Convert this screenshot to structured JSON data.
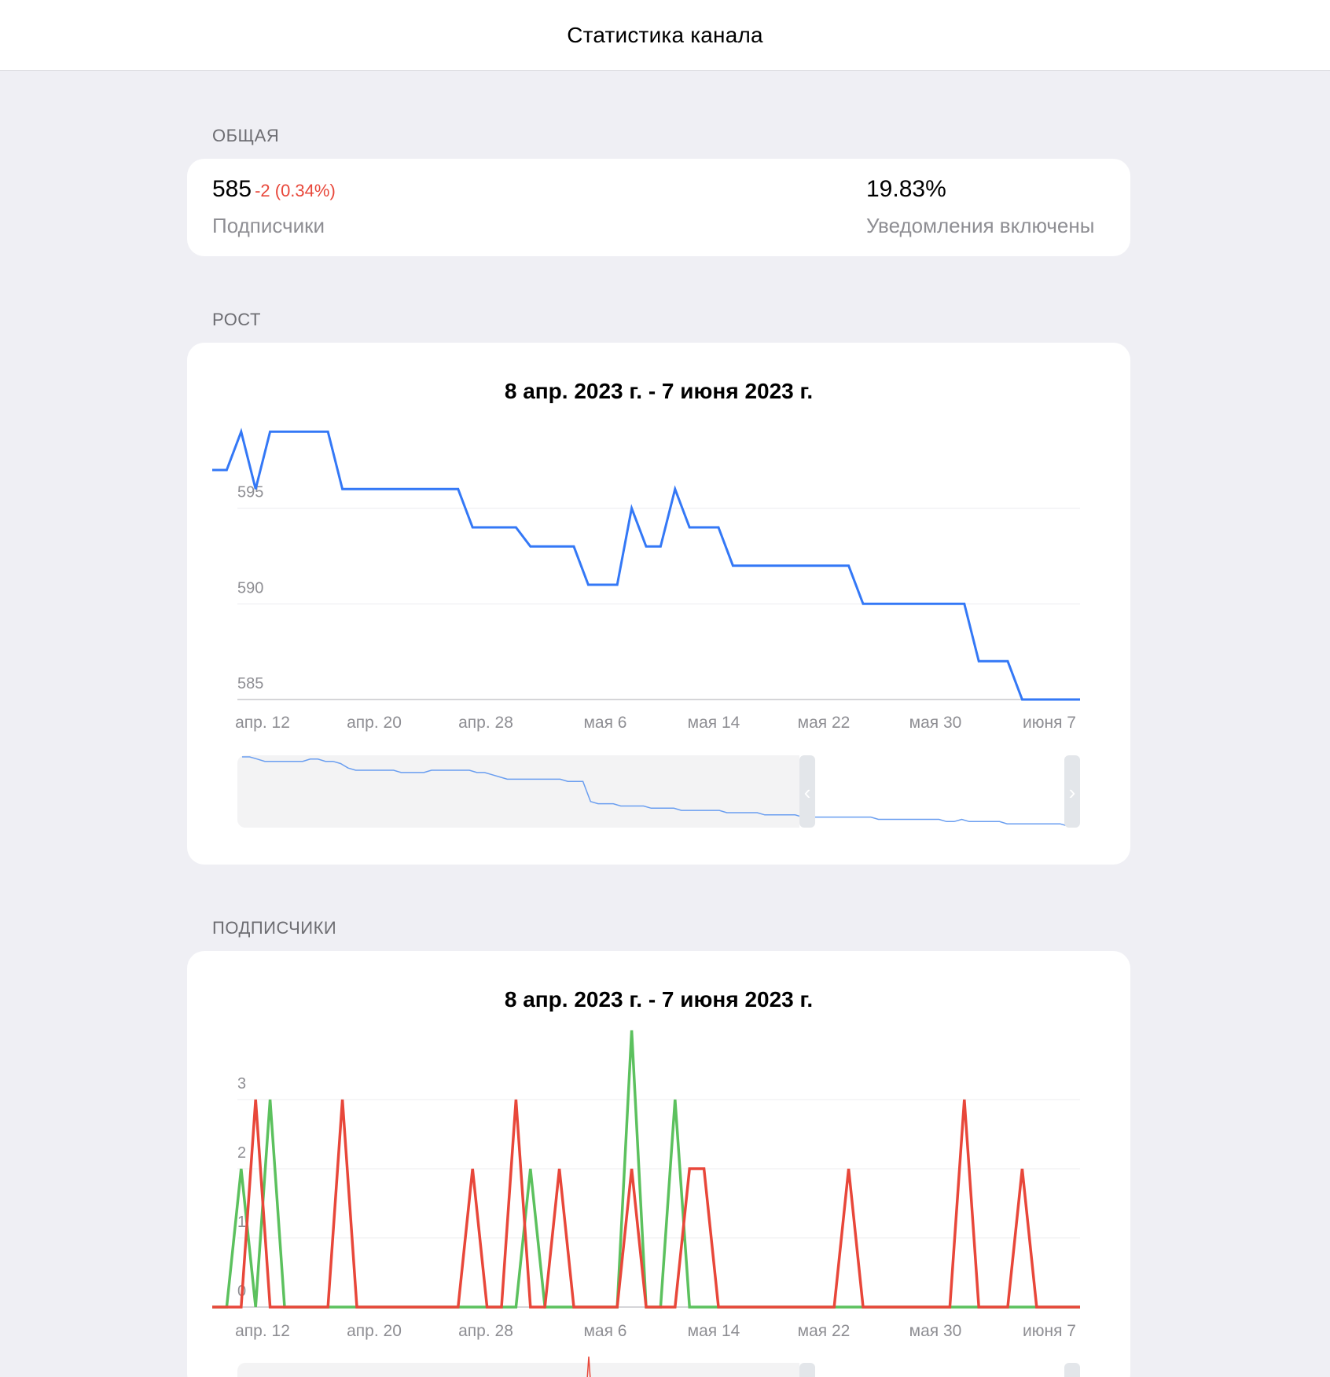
{
  "header": {
    "title": "Статистика канала"
  },
  "overview": {
    "section_label": "ОБЩАЯ",
    "subscribers": {
      "value": "585",
      "delta": "-2 (0.34%)",
      "caption": "Подписчики"
    },
    "notifications": {
      "value": "19.83%",
      "caption": "Уведомления включены"
    }
  },
  "growth": {
    "section_label": "РОСТ",
    "range_title": "8 апр. 2023 г. - 7 июня 2023 г.",
    "line_color": "#3478f6"
  },
  "followers": {
    "section_label": "ПОДПИСЧИКИ",
    "range_title": "8 апр. 2023 г. - 7 июня 2023 г.",
    "joined_color": "#5cc15e",
    "left_color": "#e8473a"
  },
  "chart_data": [
    {
      "type": "line",
      "x_ticks": [
        "апр. 12",
        "апр. 20",
        "апр. 28",
        "мая 6",
        "мая 14",
        "мая 22",
        "мая 30",
        "июня 7"
      ],
      "y_ticks": [
        "585",
        "590",
        "595"
      ],
      "ylim": [
        585,
        600
      ],
      "grid": true,
      "series": [
        {
          "values": [
            597,
            597,
            599,
            596,
            599,
            599,
            599,
            599,
            599,
            596,
            596,
            596,
            596,
            596,
            596,
            596,
            596,
            596,
            594,
            594,
            594,
            594,
            593,
            593,
            593,
            593,
            591,
            591,
            591,
            595,
            593,
            593,
            596,
            594,
            594,
            594,
            592,
            592,
            592,
            592,
            592,
            592,
            592,
            592,
            592,
            590,
            590,
            590,
            590,
            590,
            590,
            590,
            590,
            587,
            587,
            587,
            585,
            585,
            585,
            585,
            585
          ]
        }
      ],
      "navigator": {
        "values": [
          616,
          616,
          615,
          614,
          614,
          614,
          614,
          614,
          614,
          615,
          615,
          614,
          614,
          613,
          611,
          610,
          610,
          610,
          610,
          610,
          610,
          609,
          609,
          609,
          609,
          610,
          610,
          610,
          610,
          610,
          610,
          609,
          609,
          608,
          607,
          606,
          606,
          606,
          606,
          606,
          606,
          606,
          606,
          605,
          605,
          605,
          596,
          595,
          595,
          595,
          594,
          594,
          594,
          594,
          593,
          593,
          593,
          593,
          592,
          592,
          592,
          592,
          592,
          592,
          591,
          591,
          591,
          591,
          591,
          590,
          590,
          590,
          590,
          590,
          589,
          589,
          589,
          589,
          589,
          589,
          589,
          589,
          589,
          589,
          588,
          588,
          588,
          588,
          588,
          588,
          588,
          588,
          588,
          587,
          587,
          588,
          587,
          587,
          587,
          587,
          587,
          586,
          586,
          586,
          586,
          586,
          586,
          586,
          586,
          585,
          585
        ],
        "selected_range": [
          0.667,
          1.0
        ]
      }
    },
    {
      "type": "line",
      "x_ticks": [
        "апр. 12",
        "апр. 20",
        "апр. 28",
        "мая 6",
        "мая 14",
        "мая 22",
        "мая 30",
        "июня 7"
      ],
      "y_ticks": [
        "0",
        "1",
        "2",
        "3"
      ],
      "ylim": [
        0,
        4
      ],
      "grid": true,
      "series": [
        {
          "color": "#5cc15e",
          "values": [
            0,
            0,
            2,
            0,
            3,
            0,
            0,
            0,
            0,
            0,
            0,
            0,
            0,
            0,
            0,
            0,
            0,
            0,
            0,
            0,
            0,
            0,
            2,
            0,
            0,
            0,
            0,
            0,
            0,
            4,
            0,
            0,
            3,
            0,
            0,
            0,
            0,
            0,
            0,
            0,
            0,
            0,
            0,
            0,
            0,
            0,
            0,
            0,
            0,
            0,
            0,
            0,
            0,
            0,
            0,
            0,
            0,
            0,
            0,
            0,
            0
          ]
        },
        {
          "color": "#e8473a",
          "values": [
            0,
            0,
            0,
            3,
            0,
            0,
            0,
            0,
            0,
            3,
            0,
            0,
            0,
            0,
            0,
            0,
            0,
            0,
            2,
            0,
            0,
            3,
            0,
            0,
            2,
            0,
            0,
            0,
            0,
            2,
            0,
            0,
            0,
            2,
            2,
            0,
            0,
            0,
            0,
            0,
            0,
            0,
            0,
            0,
            2,
            0,
            0,
            0,
            0,
            0,
            0,
            0,
            3,
            0,
            0,
            0,
            2,
            0,
            0,
            0,
            0
          ]
        }
      ]
    }
  ]
}
